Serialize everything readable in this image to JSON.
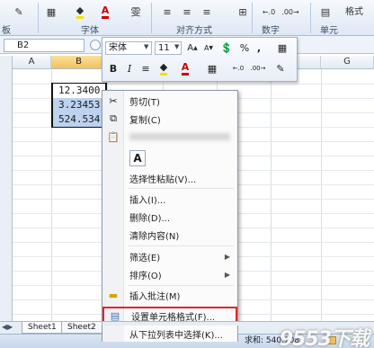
{
  "ribbon": {
    "group_labels": [
      "板",
      "字体",
      "对齐方式",
      "数字",
      "单元"
    ],
    "format_label": "格式"
  },
  "formula_bar": {
    "name_box": "B2"
  },
  "columns": [
    "A",
    "B",
    "C",
    "D",
    "E",
    "F",
    "G"
  ],
  "cells": {
    "b1": "12.3400",
    "b2": "3.23453",
    "b3": "524.534"
  },
  "mini_toolbar": {
    "font_name": "宋体",
    "font_size": "11",
    "percent": "%",
    "comma": ",",
    "bold": "B",
    "italic": "I",
    "font_color_letter": "A"
  },
  "context_menu": {
    "items": [
      {
        "label": "剪切(T)"
      },
      {
        "label": "复制(C)"
      },
      {
        "label": ""
      },
      {
        "label": "选择性粘贴(V)..."
      },
      {
        "label": "插入(I)..."
      },
      {
        "label": "删除(D)..."
      },
      {
        "label": "清除内容(N)"
      },
      {
        "label": "筛选(E)"
      },
      {
        "label": "排序(O)"
      },
      {
        "label": "插入批注(M)"
      },
      {
        "label": "设置单元格格式(F)..."
      },
      {
        "label": "从下拉列表中选择(K)..."
      }
    ],
    "paste_option_letter": "A"
  },
  "sheet_tabs": [
    "Sheet1",
    "Sheet2"
  ],
  "status_bar": {
    "sum_text": "求和: 540.1085"
  },
  "watermark": "9553下载",
  "colors": {
    "highlight_border": "#e0262b",
    "selection_fill": "#bcd2ef",
    "selected_header": "#f1c15f"
  }
}
